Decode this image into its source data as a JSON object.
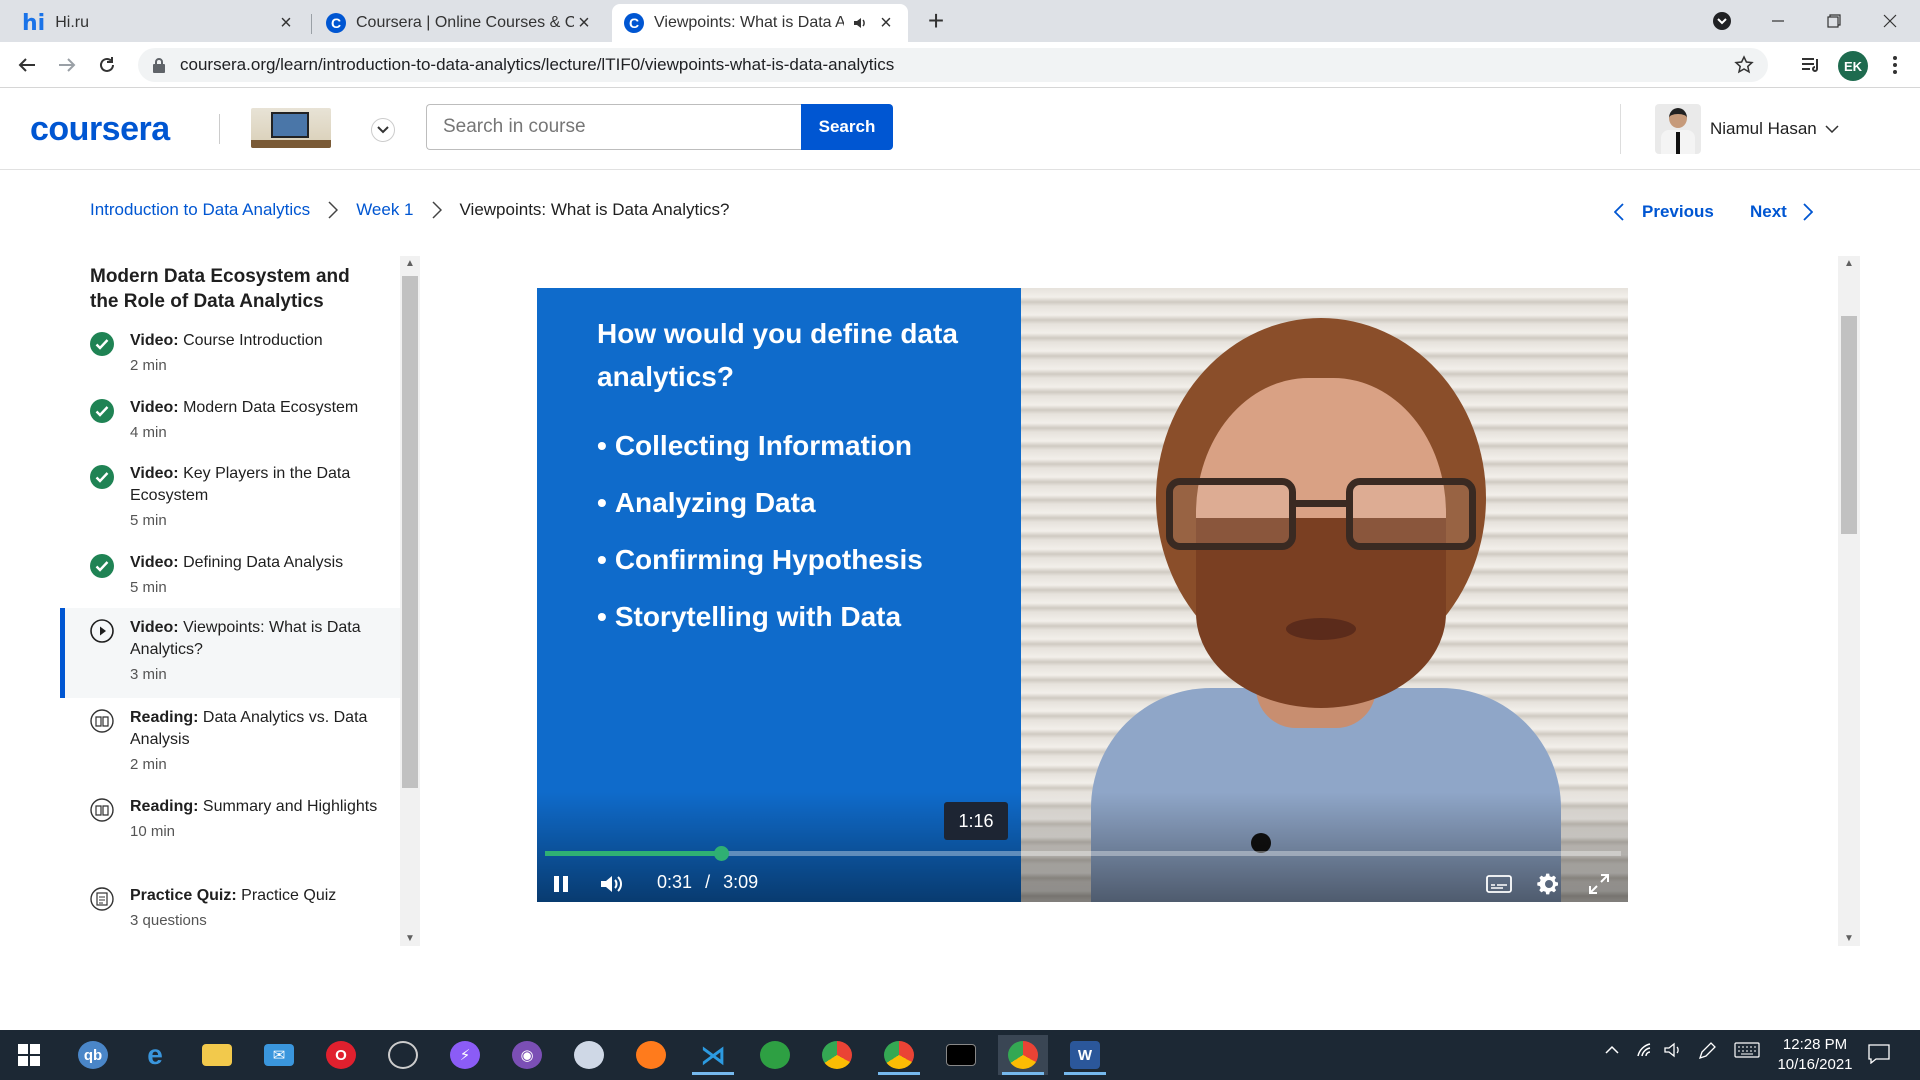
{
  "browser": {
    "tabs": [
      {
        "title": "Hi.ru",
        "favicon": "hi-favicon",
        "active": false
      },
      {
        "title": "Coursera | Online Courses & Crec",
        "favicon": "coursera-favicon",
        "active": false
      },
      {
        "title": "Viewpoints: What is Data An",
        "favicon": "coursera-favicon",
        "active": true
      }
    ],
    "url": "coursera.org/learn/introduction-to-data-analytics/lecture/lTIF0/viewpoints-what-is-data-analytics",
    "profile_initials": "EK"
  },
  "header": {
    "logo": "coursera",
    "search_placeholder": "Search in course",
    "search_button": "Search",
    "user_name": "Niamul Hasan"
  },
  "breadcrumb": {
    "course": "Introduction to Data Analytics",
    "week": "Week 1",
    "current": "Viewpoints: What is Data Analytics?"
  },
  "nav": {
    "previous": "Previous",
    "next": "Next"
  },
  "sidebar": {
    "module_title": "Modern Data Ecosystem and the Role of Data Analytics",
    "items": [
      {
        "type": "Video:",
        "title": "Course Introduction",
        "duration": "2 min",
        "status": "completed"
      },
      {
        "type": "Video:",
        "title": "Modern Data Ecosystem",
        "duration": "4 min",
        "status": "completed"
      },
      {
        "type": "Video:",
        "title": "Key Players in the Data Ecosystem",
        "duration": "5 min",
        "status": "completed"
      },
      {
        "type": "Video:",
        "title": "Defining Data Analysis",
        "duration": "5 min",
        "status": "completed"
      },
      {
        "type": "Video:",
        "title": "Viewpoints: What is Data Analytics?",
        "duration": "3 min",
        "status": "current"
      },
      {
        "type": "Reading:",
        "title": "Data Analytics vs. Data Analysis",
        "duration": "2 min",
        "status": "reading"
      },
      {
        "type": "Reading:",
        "title": "Summary and Highlights",
        "duration": "10 min",
        "status": "reading"
      },
      {
        "type": "Practice Quiz:",
        "title": "Practice Quiz",
        "duration": "3 questions",
        "status": "quiz"
      }
    ]
  },
  "video": {
    "slide_question": "How would you define data analytics?",
    "slide_bullets": [
      "Collecting Information",
      "Analyzing Data",
      "Confirming Hypothesis",
      "Storytelling with Data"
    ],
    "hover_time": "1:16",
    "current_time": "0:31",
    "time_separator": "/",
    "duration": "3:09",
    "progress_fraction": 0.164
  },
  "taskbar": {
    "time": "12:28 PM",
    "date": "10/16/2021"
  },
  "colors": {
    "brand": "#0056d2",
    "success": "#1f8354",
    "progress": "#2fb073",
    "slide_blue": "#0f6bcb"
  }
}
